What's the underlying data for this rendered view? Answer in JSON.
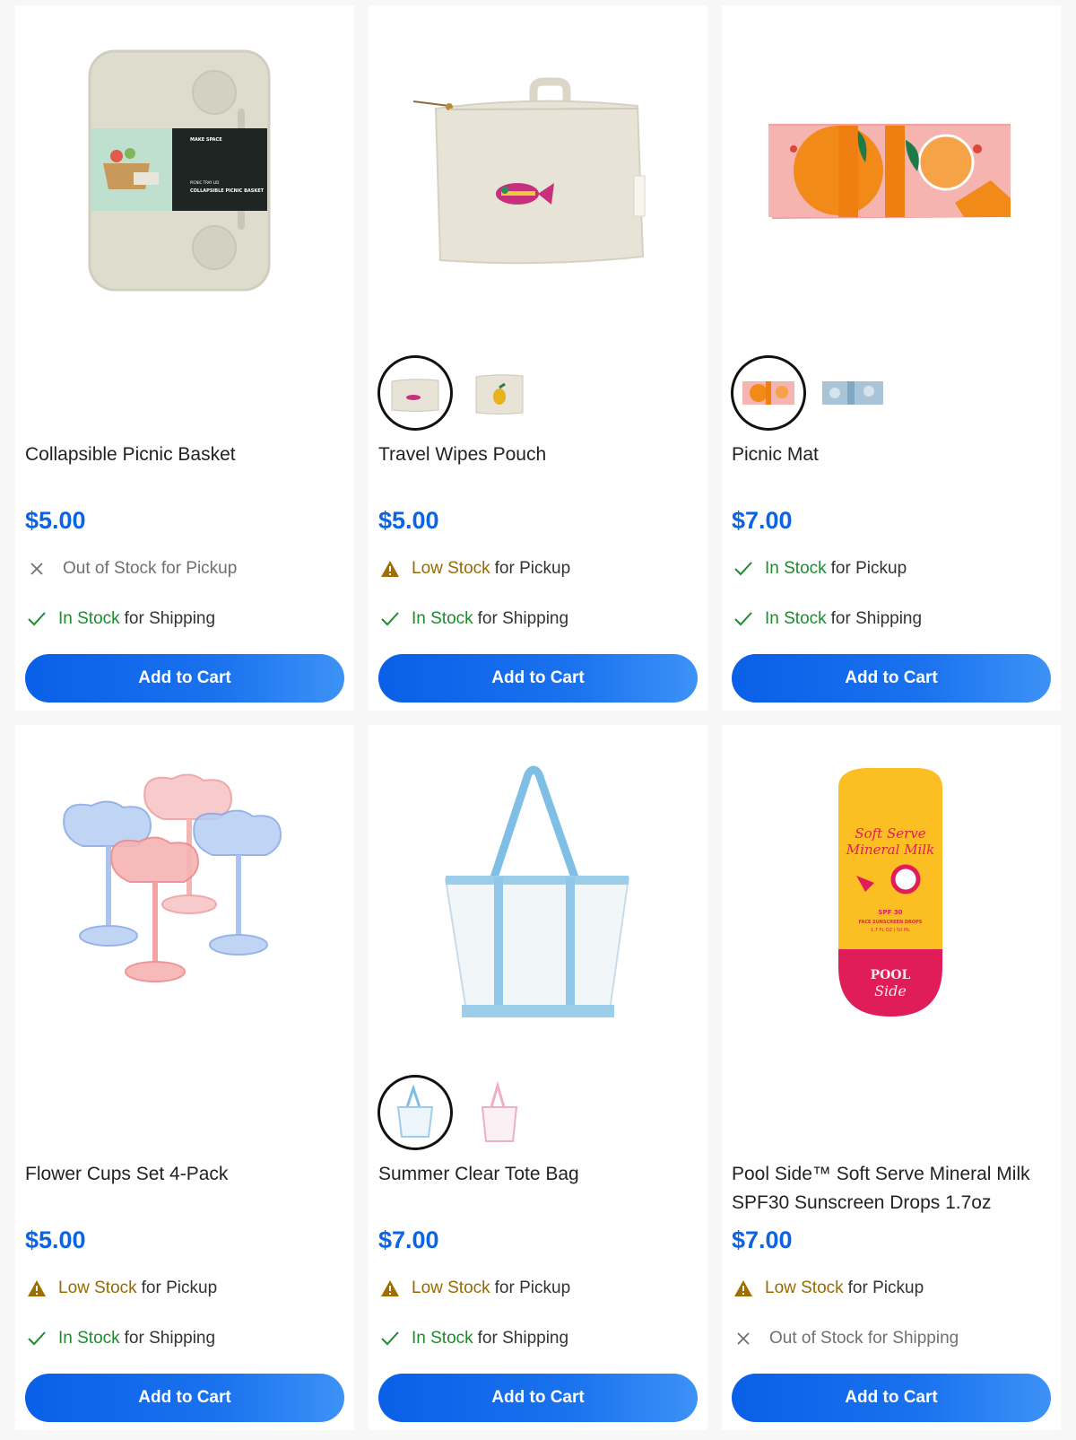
{
  "products": [
    {
      "name": "Collapsible Picnic Basket",
      "price": "$5.00",
      "package_label_1": "MAKE SPACE",
      "package_label_2": "PICNIC TRAY LID",
      "package_label_3": "COLLAPSIBLE PICNIC BASKET",
      "pickup": {
        "status": "",
        "suffix": "Out of Stock for Pickup"
      },
      "shipping": {
        "status": "In Stock",
        "suffix": "for Shipping"
      },
      "cta": "Add to Cart"
    },
    {
      "name": "Travel Wipes Pouch",
      "price": "$5.00",
      "swatches": [
        "fish-pouch-swatch",
        "lemon-pouch-swatch"
      ],
      "pickup": {
        "status": "Low Stock",
        "suffix": "for Pickup"
      },
      "shipping": {
        "status": "In Stock",
        "suffix": "for Shipping"
      },
      "cta": "Add to Cart"
    },
    {
      "name": "Picnic Mat",
      "price": "$7.00",
      "swatches": [
        "orange-mat-swatch",
        "blue-mat-swatch"
      ],
      "pickup": {
        "status": "In Stock",
        "suffix": "for Pickup"
      },
      "shipping": {
        "status": "In Stock",
        "suffix": "for Shipping"
      },
      "cta": "Add to Cart"
    },
    {
      "name": "Flower Cups Set 4-Pack",
      "price": "$5.00",
      "pickup": {
        "status": "Low Stock",
        "suffix": "for Pickup"
      },
      "shipping": {
        "status": "In Stock",
        "suffix": "for Shipping"
      },
      "cta": "Add to Cart"
    },
    {
      "name": "Summer Clear Tote Bag",
      "price": "$7.00",
      "swatches": [
        "blue-tote-swatch",
        "pink-tote-swatch"
      ],
      "pickup": {
        "status": "Low Stock",
        "suffix": "for Pickup"
      },
      "shipping": {
        "status": "In Stock",
        "suffix": "for Shipping"
      },
      "cta": "Add to Cart"
    },
    {
      "name": "Pool Side™ Soft Serve Mineral Milk SPF30 Sunscreen Drops 1.7oz",
      "price": "$7.00",
      "bottle_label_1": "Soft Serve",
      "bottle_label_2": "Mineral Milk",
      "bottle_label_3": "SPF 30",
      "bottle_label_4": "FACE SUNSCREEN DROPS",
      "bottle_label_5": "1.7 FL OZ | 50 ML",
      "bottle_brand_1": "POOL",
      "bottle_brand_2": "Side",
      "pickup": {
        "status": "Low Stock",
        "suffix": "for Pickup"
      },
      "shipping": {
        "status": "",
        "suffix": "Out of Stock for Shipping"
      },
      "cta": "Add to Cart"
    }
  ],
  "colors": {
    "price": "#0b63e5",
    "in_stock": "#1f8a2e",
    "low_stock": "#9a6a00",
    "out_of_stock": "#707070",
    "button": "#0a5fe8",
    "warning_icon": "#a06d00"
  }
}
